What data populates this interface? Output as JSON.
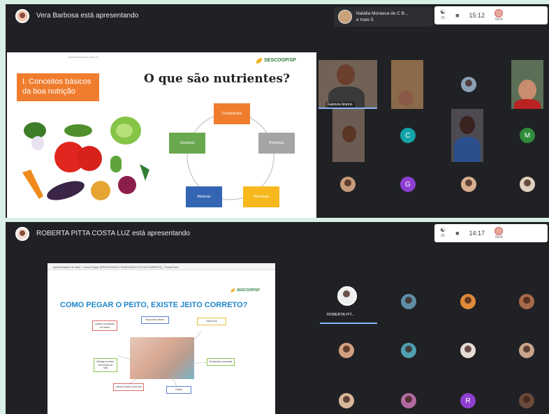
{
  "session_top": {
    "presenting_text": "Vera Barbosa está apresentando",
    "participant_chip": {
      "name": "Natália Moraeca de C B...",
      "more": "e mais 5"
    },
    "clock": "15:12",
    "you_label": "Você",
    "slide": {
      "url": "www.sescoopsp.coop.br",
      "logo": "SESCOOP/SP",
      "section_box": "I. Conceitos básicos da boa nutrição",
      "title": "O que são nutrientes?",
      "nodes": [
        "Carboidratos",
        "Proteínas",
        "Vitaminas",
        "Minerais",
        "Gorduras"
      ]
    },
    "speaker_label": "Gabriela Marino",
    "letter_avatars": [
      "C",
      "M",
      "G"
    ],
    "colors": {
      "c": "#12a4a8",
      "m": "#2e8b3a",
      "g": "#8e3fd1"
    }
  },
  "session_bottom": {
    "presenting_text": "ROBERTA PITTA COSTA LUZ está apresentando",
    "clock": "14:17",
    "you_label": "Você",
    "ppt_titlebar": "Apresentação do slide - Como Pegar [PROCURADO / RASCUNHO DO DOCUMENTO] - PowerPoint",
    "slide": {
      "logo": "SESCOOP/SP",
      "title": "COMO PEGAR O PEITO, EXISTE JEITO CORRETO?",
      "callouts": [
        "Queixo encostado na mama",
        "Boca bem aberta",
        "Nariz livre",
        "Barriga do bebê encostada na mãe",
        "Bochechas redondas",
        "Lábios virados para fora"
      ]
    },
    "presenter_tile_label": "ROBERTA PIT...",
    "letter_avatars": [
      "R"
    ],
    "colors": {
      "r": "#8e3fd1"
    }
  }
}
